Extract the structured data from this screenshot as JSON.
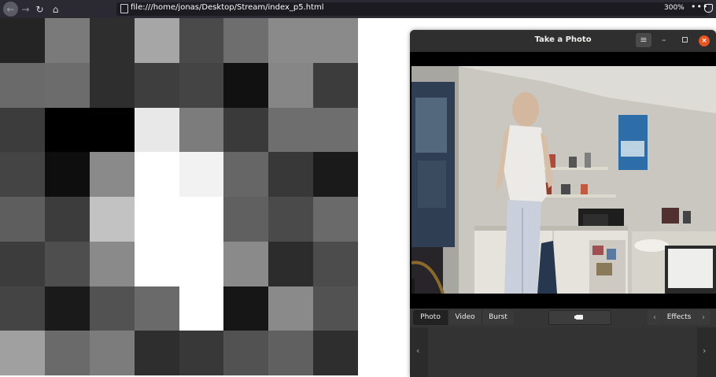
{
  "browser": {
    "url": "file:///home/jonas/Desktop/Stream/index_p5.html",
    "zoom": "300%",
    "menu": "•••",
    "icons": [
      "back-arrow-icon",
      "forward-arrow-icon",
      "reload-icon",
      "home-icon",
      "page-icon",
      "menu-dots-icon",
      "pocket-icon"
    ]
  },
  "grid": {
    "rows": 8,
    "cols": 8,
    "cells": [
      "#242424",
      "#7a7a7a",
      "#2e2e2e",
      "#a6a6a6",
      "#4a4a4a",
      "#6e6e6e",
      "#8a8a8a",
      "#8a8a8a",
      "#6a6a6a",
      "#6c6c6c",
      "#2e2e2e",
      "#3e3e3e",
      "#444444",
      "#111111",
      "#868686",
      "#3c3c3c",
      "#3c3c3c",
      "#000000",
      "#000000",
      "#e8e8e8",
      "#7c7c7c",
      "#3a3a3a",
      "#6e6e6e",
      "#6e6e6e",
      "#444444",
      "#0e0e0e",
      "#8a8a8a",
      "#ffffff",
      "#f2f2f2",
      "#666666",
      "#383838",
      "#1a1a1a",
      "#5e5e5e",
      "#3c3c3c",
      "#c2c2c2",
      "#ffffff",
      "#ffffff",
      "#606060",
      "#4a4a4a",
      "#6a6a6a",
      "#3c3c3c",
      "#4e4e4e",
      "#8a8a8a",
      "#ffffff",
      "#ffffff",
      "#8a8a8a",
      "#2c2c2c",
      "#4c4c4c",
      "#444444",
      "#1a1a1a",
      "#525252",
      "#6a6a6a",
      "#ffffff",
      "#161616",
      "#8a8a8a",
      "#525252",
      "#a0a0a0",
      "#6a6a6a",
      "#7c7c7c",
      "#2e2e2e",
      "#383838",
      "#525252",
      "#606060",
      "#2e2e2e"
    ]
  },
  "cheese": {
    "title": "Take a Photo",
    "menu_glyph": "≡",
    "minimize_glyph": "–",
    "close_glyph": "×",
    "modes": {
      "photo": "Photo",
      "video": "Video",
      "burst": "Burst"
    },
    "active_mode": "Photo",
    "effects_label": "Effects",
    "prev_glyph": "‹",
    "next_glyph": "›",
    "strip_prev": "‹",
    "strip_next": "›"
  }
}
